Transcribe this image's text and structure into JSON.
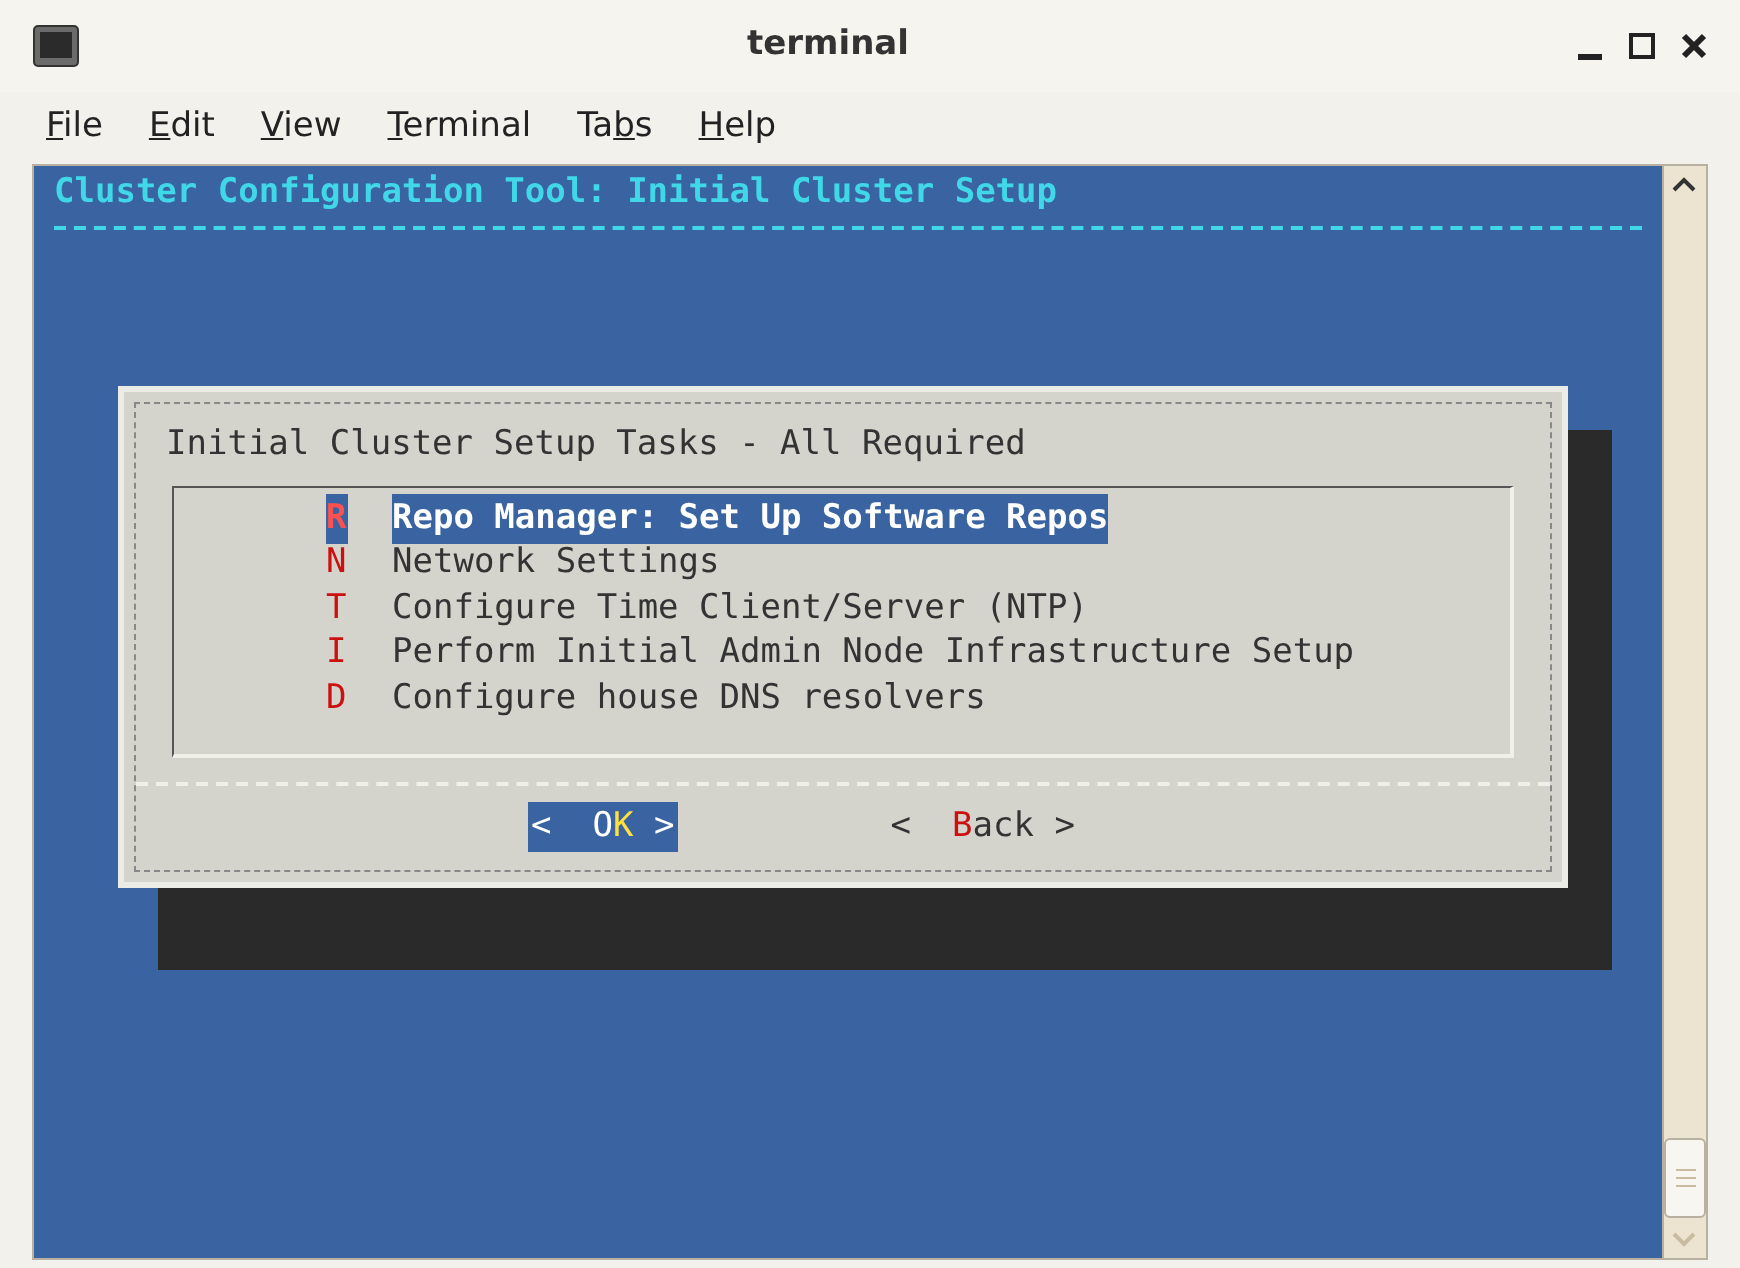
{
  "window": {
    "title": "terminal"
  },
  "menu": [
    {
      "hotkey": "F",
      "after": "ile"
    },
    {
      "hotkey": "E",
      "after": "dit"
    },
    {
      "hotkey": "V",
      "after": "iew"
    },
    {
      "hotkey": "T",
      "after": "erminal"
    },
    {
      "before": "Ta",
      "hotkey": "b",
      "after": "s"
    },
    {
      "hotkey": "H",
      "after": "elp"
    }
  ],
  "screen": {
    "heading": "Cluster Configuration Tool: Initial Cluster Setup",
    "dialog": {
      "title": "Initial Cluster Setup Tasks - All Required",
      "items": [
        {
          "key": "R",
          "label": "Repo Manager: Set Up Software Repos",
          "selected": true
        },
        {
          "key": "N",
          "label": "Network Settings",
          "selected": false
        },
        {
          "key": "T",
          "label": "Configure Time Client/Server (NTP)",
          "selected": false
        },
        {
          "key": "I",
          "label": "Perform Initial Admin Node Infrastructure Setup",
          "selected": false
        },
        {
          "key": "D",
          "label": "Configure house DNS resolvers",
          "selected": false
        }
      ],
      "buttons": [
        {
          "open": "<",
          "before": "O",
          "hotkey": "K",
          "close": ">",
          "selected": true
        },
        {
          "open": "<",
          "hotkey": "B",
          "after": "ack",
          "close": ">",
          "selected": false
        }
      ]
    }
  }
}
